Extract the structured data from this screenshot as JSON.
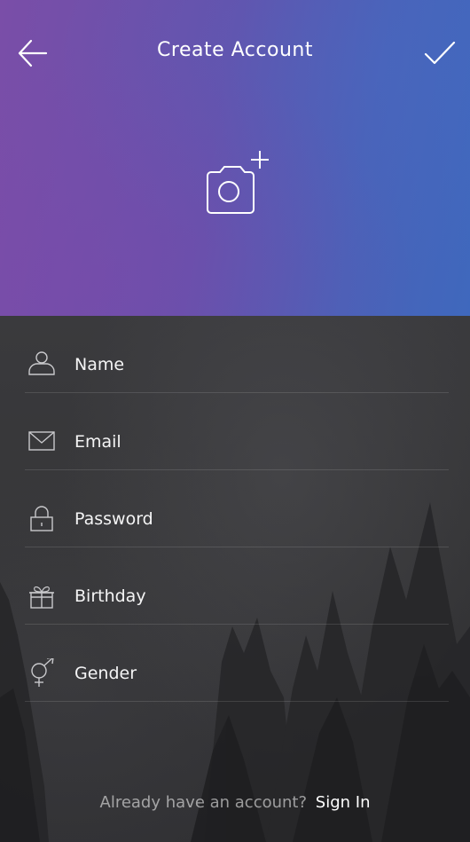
{
  "header": {
    "title": "Create Account",
    "back_icon": "arrow-left-icon",
    "confirm_icon": "checkmark-icon",
    "photo_icon": "camera-add-icon",
    "gradient_start": "#7a4ea8",
    "gradient_end": "#3f68bd"
  },
  "form": {
    "fields": [
      {
        "label": "Name",
        "icon": "user-icon"
      },
      {
        "label": "Email",
        "icon": "envelope-icon"
      },
      {
        "label": "Password",
        "icon": "lock-icon"
      },
      {
        "label": "Birthday",
        "icon": "gift-icon"
      },
      {
        "label": "Gender",
        "icon": "gender-icon"
      }
    ]
  },
  "footer": {
    "prompt": "Already have an account?",
    "link": "Sign In"
  }
}
